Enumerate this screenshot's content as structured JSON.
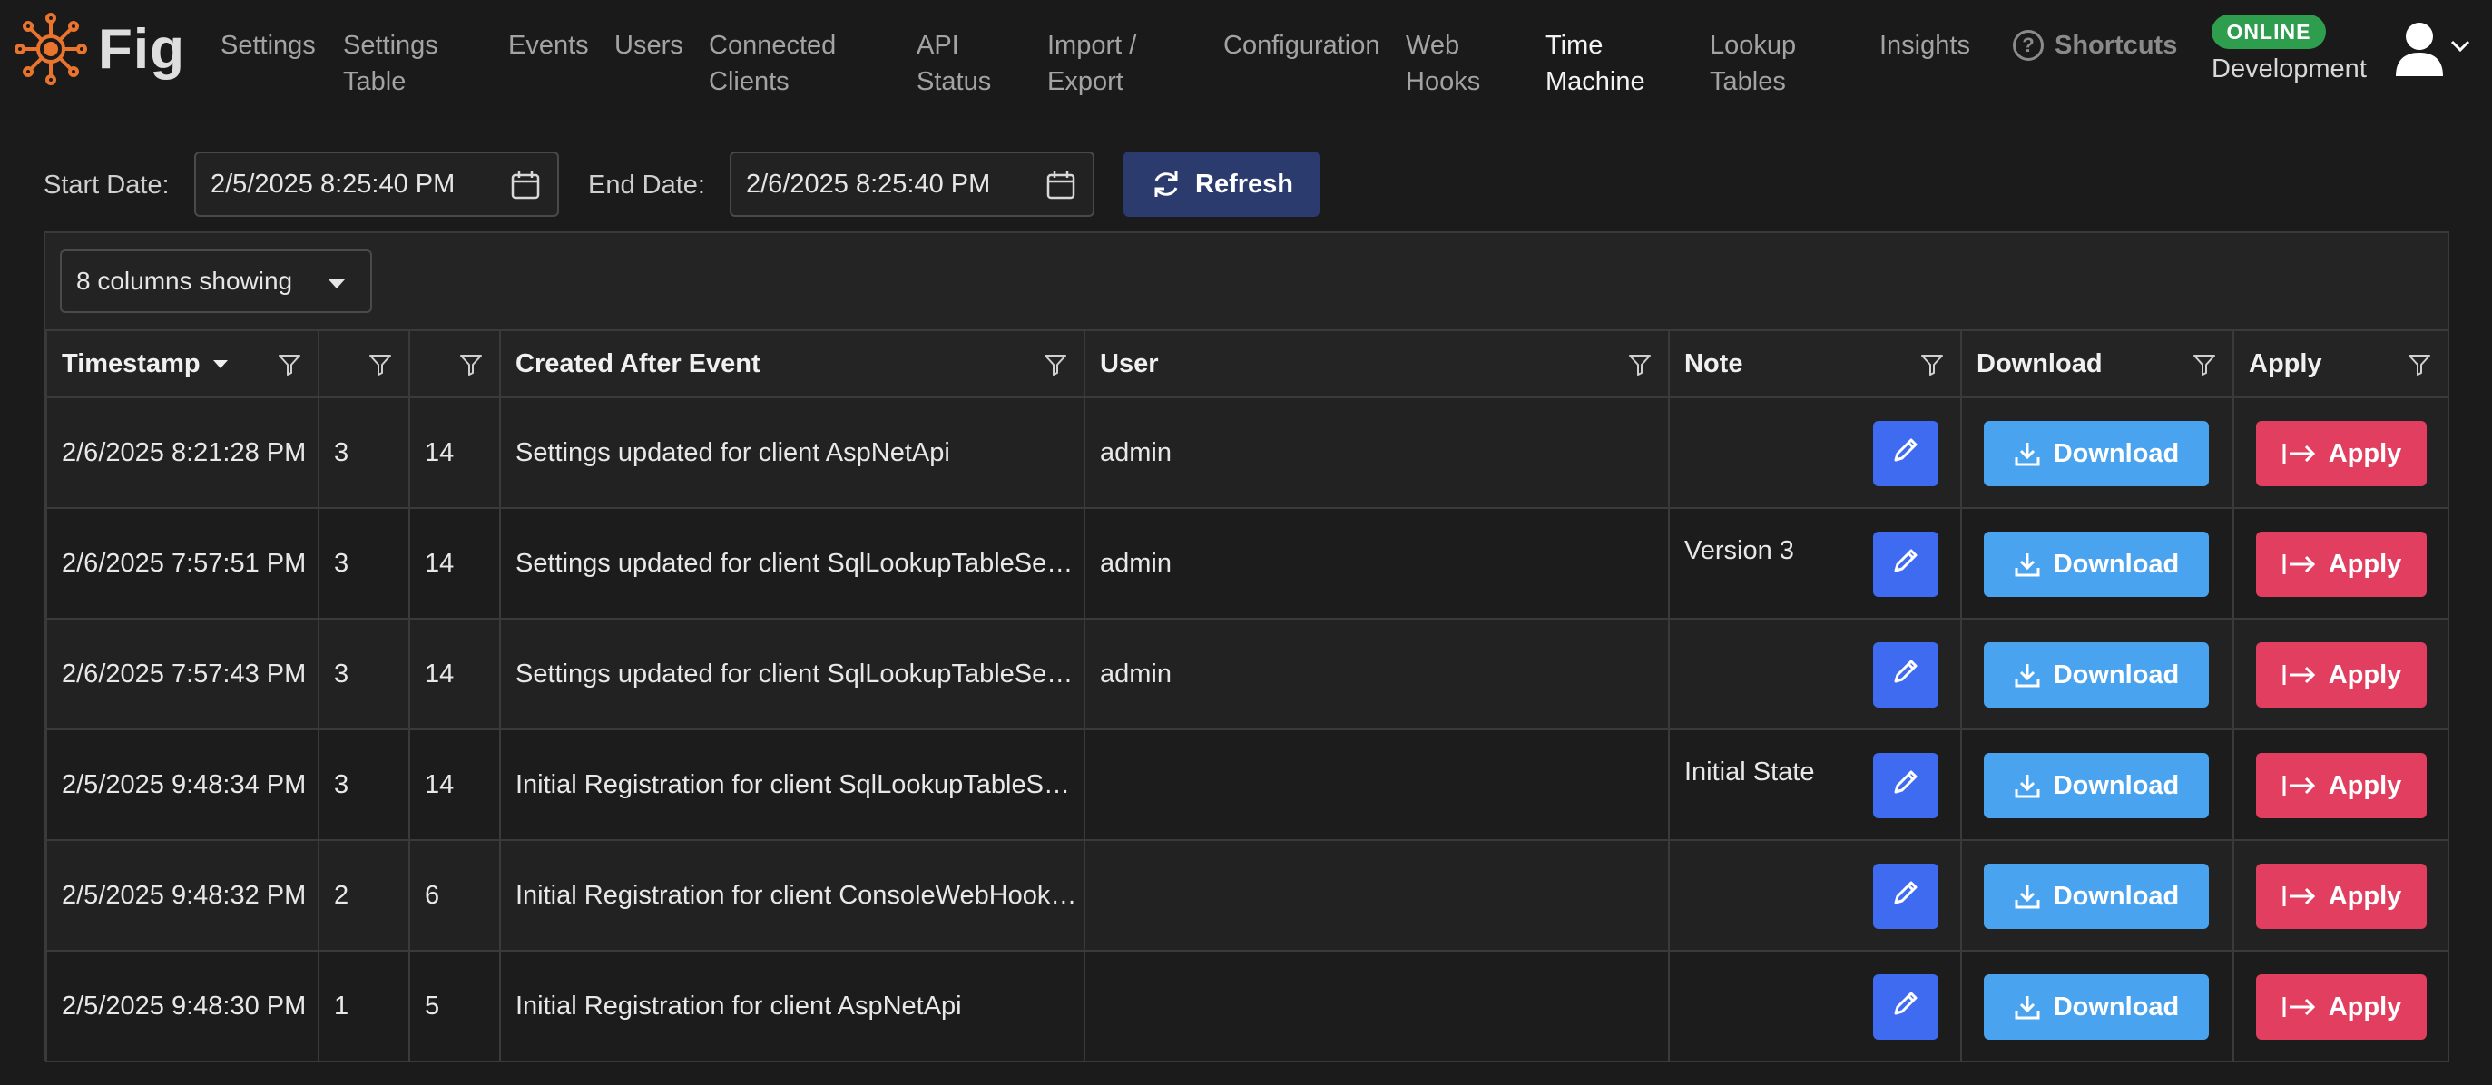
{
  "app": {
    "name": "Fig",
    "status": "ONLINE",
    "environment": "Development"
  },
  "colors": {
    "accent_orange": "#e8742e",
    "edit_blue": "#3e6bf0",
    "download_blue": "#4aa3ef",
    "apply_red": "#e23e60",
    "refresh_navy": "#2c3b6e",
    "online_green": "#2e9e4e"
  },
  "nav": {
    "items": [
      {
        "label": "Settings",
        "active": false
      },
      {
        "label": "Settings\nTable",
        "active": false
      },
      {
        "label": "Events",
        "active": false
      },
      {
        "label": "Users",
        "active": false
      },
      {
        "label": "Connected\nClients",
        "active": false
      },
      {
        "label": "API\nStatus",
        "active": false
      },
      {
        "label": "Import /\nExport",
        "active": false
      },
      {
        "label": "Configuration",
        "active": false
      },
      {
        "label": "Web\nHooks",
        "active": false
      },
      {
        "label": "Time\nMachine",
        "active": true
      },
      {
        "label": "Lookup\nTables",
        "active": false
      },
      {
        "label": "Insights",
        "active": false
      }
    ],
    "shortcuts_label": "Shortcuts",
    "shortcuts_icon": "question-circle-icon"
  },
  "filters": {
    "start_label": "Start Date:",
    "start_value": "2/5/2025 8:25:40 PM",
    "end_label": "End Date:",
    "end_value": "2/6/2025 8:25:40 PM",
    "refresh_label": "Refresh"
  },
  "grid": {
    "columns_selector": "8 columns showing",
    "columns": [
      {
        "label": "Timestamp",
        "sorted": "desc"
      },
      {
        "label": ""
      },
      {
        "label": ""
      },
      {
        "label": "Created After Event"
      },
      {
        "label": "User"
      },
      {
        "label": "Note"
      },
      {
        "label": "Download"
      },
      {
        "label": "Apply"
      }
    ],
    "download_label": "Download",
    "apply_label": "Apply",
    "rows": [
      {
        "timestamp": "2/6/2025 8:21:28 PM",
        "col2": "3",
        "col3": "14",
        "event": "Settings updated for client AspNetApi",
        "user": "admin",
        "note": ""
      },
      {
        "timestamp": "2/6/2025 7:57:51 PM",
        "col2": "3",
        "col3": "14",
        "event": "Settings updated for client SqlLookupTableSe…",
        "user": "admin",
        "note": "Version 3"
      },
      {
        "timestamp": "2/6/2025 7:57:43 PM",
        "col2": "3",
        "col3": "14",
        "event": "Settings updated for client SqlLookupTableSe…",
        "user": "admin",
        "note": ""
      },
      {
        "timestamp": "2/5/2025 9:48:34 PM",
        "col2": "3",
        "col3": "14",
        "event": "Initial Registration for client SqlLookupTableSe…",
        "user": "",
        "note": "Initial State"
      },
      {
        "timestamp": "2/5/2025 9:48:32 PM",
        "col2": "2",
        "col3": "6",
        "event": "Initial Registration for client ConsoleWebHook…",
        "user": "",
        "note": ""
      },
      {
        "timestamp": "2/5/2025 9:48:30 PM",
        "col2": "1",
        "col3": "5",
        "event": "Initial Registration for client AspNetApi",
        "user": "",
        "note": ""
      }
    ]
  }
}
